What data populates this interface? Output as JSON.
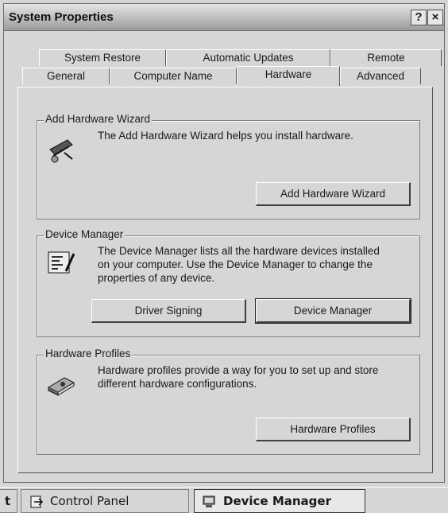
{
  "window": {
    "title": "System Properties",
    "help_button": "?",
    "close_button": "×"
  },
  "tabs": {
    "row1": [
      "System Restore",
      "Automatic Updates",
      "Remote"
    ],
    "row2": [
      "General",
      "Computer Name",
      "Hardware",
      "Advanced"
    ]
  },
  "add_hardware": {
    "title": "Add Hardware Wizard",
    "description": "The Add Hardware Wizard helps you install hardware.",
    "button": "Add Hardware Wizard",
    "icon": "wizard-icon"
  },
  "device_manager": {
    "title": "Device Manager",
    "description_line1": "The Device Manager lists all the hardware devices installed",
    "description_line2": "on your computer. Use the Device Manager to change the",
    "description_line3": "properties of any device.",
    "driver_signing_button": "Driver Signing",
    "device_manager_button": "Device Manager",
    "icon": "device-manager-icon"
  },
  "hardware_profiles": {
    "title": "Hardware Profiles",
    "description_line1": "Hardware profiles provide a way for you to set up and store",
    "description_line2": "different hardware configurations.",
    "button": "Hardware Profiles",
    "icon": "hardware-profile-icon"
  },
  "taskbar": {
    "left_fragment": "t",
    "items": [
      {
        "label": "Control Panel",
        "icon": "control-panel-icon"
      },
      {
        "label": "Device Manager",
        "icon": "device-manager-task-icon"
      }
    ]
  }
}
